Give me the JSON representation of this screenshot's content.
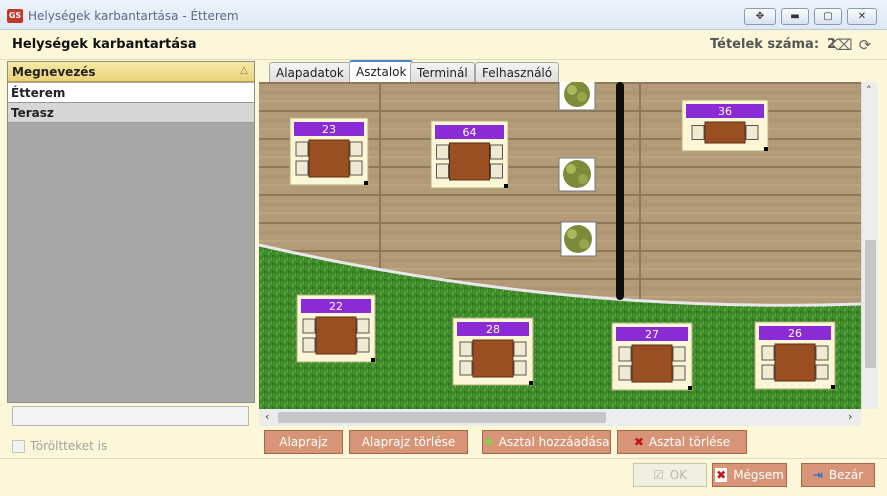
{
  "window": {
    "title": "Helységek karbantartása - Étterem",
    "app_icon": "app-icon"
  },
  "header": {
    "title": "Helységek karbantartása",
    "count_label": "Tételek száma:",
    "count_value": "2"
  },
  "list": {
    "column_header": "Megnevezés",
    "rows": [
      "Étterem",
      "Terasz"
    ],
    "filter_value": "",
    "deleted_checkbox_label": "Töröltteket is"
  },
  "tabs": [
    "Alapadatok",
    "Asztalok",
    "Terminál",
    "Felhasználó"
  ],
  "active_tab": "Asztalok",
  "floorplan": {
    "tables": [
      {
        "number": "23"
      },
      {
        "number": "64"
      },
      {
        "number": "36"
      },
      {
        "number": "22"
      },
      {
        "number": "28"
      },
      {
        "number": "27"
      },
      {
        "number": "26"
      }
    ],
    "colors": {
      "wood": "#b39a78",
      "grass": "#3f8a2a",
      "table_label": "#8a2bd6",
      "table_top": "#9a4f23"
    }
  },
  "actions": {
    "floorplan": "Alaprajz",
    "delete_floorplan": "Alaprajz törlése",
    "add_table": "Asztal hozzáadása",
    "delete_table": "Asztal törlése"
  },
  "footer": {
    "ok": "OK",
    "cancel": "Mégsem",
    "close": "Bezár"
  }
}
